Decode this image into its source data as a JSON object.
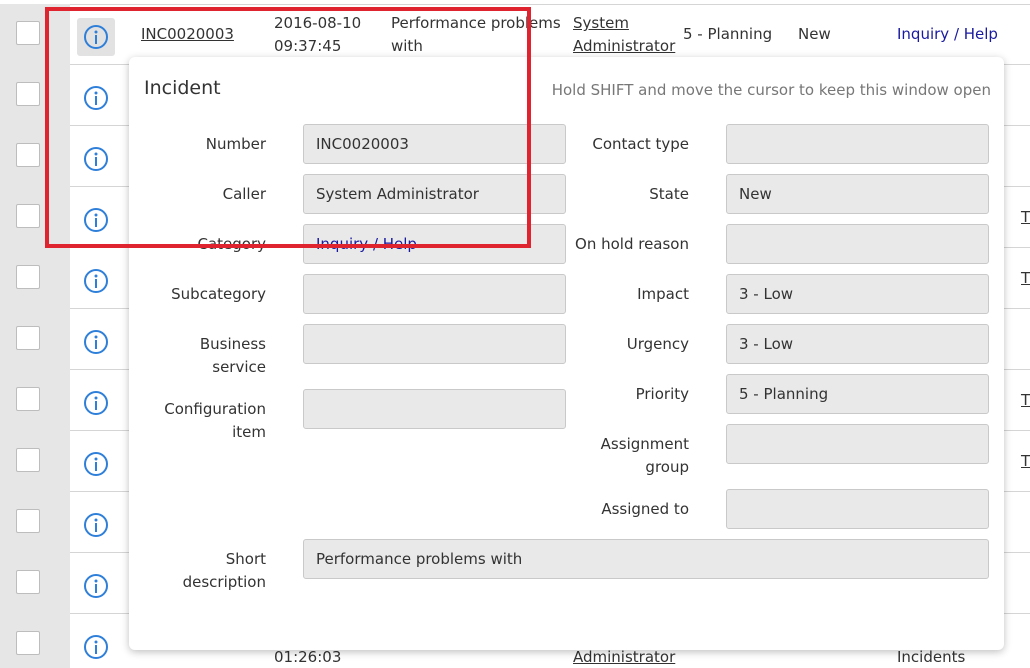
{
  "list": {
    "top_row": {
      "number": "INC0020003",
      "opened_date": "2016-08-10",
      "opened_time": "09:37:45",
      "short_description_line1": "Performance problems",
      "short_description_line2": "with",
      "caller_line1": "System",
      "caller_line2": "Administrator",
      "priority": "5 - Planning",
      "state": "New",
      "category": "Inquiry / Help"
    },
    "bottom_row": {
      "opened_time": "01:26:03",
      "caller_line2": "Administrator",
      "category": "Incidents"
    },
    "edge_letter": "T"
  },
  "popup": {
    "title": "Incident",
    "hint": "Hold SHIFT and move the cursor to keep this window open",
    "fields": {
      "number": {
        "label": "Number",
        "value": "INC0020003"
      },
      "caller": {
        "label": "Caller",
        "value": "System Administrator"
      },
      "category": {
        "label": "Category",
        "value": "Inquiry / Help"
      },
      "subcategory": {
        "label": "Subcategory",
        "value": ""
      },
      "business_service": {
        "label_line1": "Business",
        "label_line2": "service",
        "value": ""
      },
      "configuration_item": {
        "label_line1": "Configuration",
        "label_line2": "item",
        "value": ""
      },
      "short_description": {
        "label_line1": "Short",
        "label_line2": "description",
        "value": "Performance problems with"
      },
      "contact_type": {
        "label": "Contact type",
        "value": ""
      },
      "state": {
        "label": "State",
        "value": "New"
      },
      "on_hold_reason": {
        "label": "On hold reason",
        "value": ""
      },
      "impact": {
        "label": "Impact",
        "value": "3 - Low"
      },
      "urgency": {
        "label": "Urgency",
        "value": "3 - Low"
      },
      "priority": {
        "label": "Priority",
        "value": "5 - Planning"
      },
      "assignment_group": {
        "label_line1": "Assignment",
        "label_line2": "group",
        "value": ""
      },
      "assigned_to": {
        "label": "Assigned to",
        "value": ""
      }
    }
  },
  "icons": {
    "info": "info-circle-icon"
  },
  "colors": {
    "icon_blue": "#2e7fd9",
    "link_blue": "#1a1aa0",
    "annotation_red": "#e0242f"
  }
}
